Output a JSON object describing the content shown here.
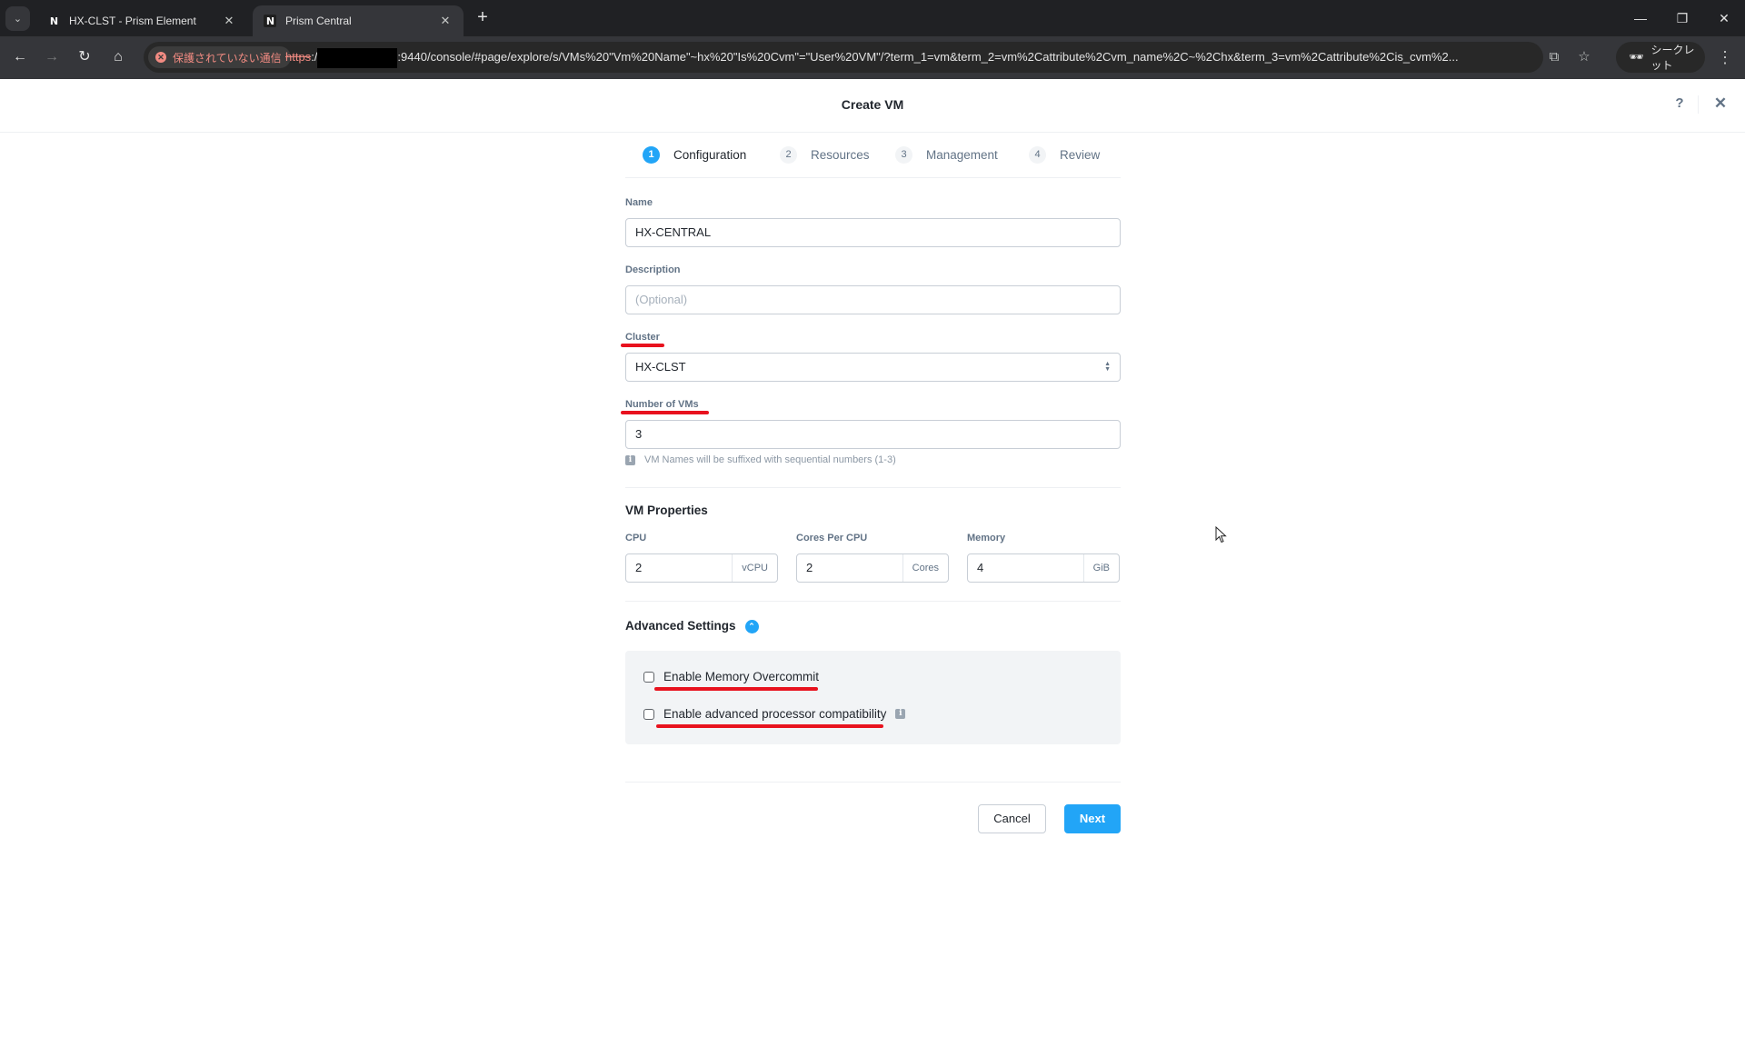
{
  "browser": {
    "tabs": [
      {
        "title": "HX-CLST - Prism Element",
        "favicon": "N",
        "active": false
      },
      {
        "title": "Prism Central",
        "favicon": "N",
        "active": true
      }
    ],
    "security_label": "保護されていない通信",
    "url_scheme": "https",
    "url_sep": ":/",
    "url_rest": ":9440/console/#page/explore/s/VMs%20\"Vm%20Name\"~hx%20\"Is%20Cvm\"=\"User%20VM\"/?term_1=vm&term_2=vm%2Cattribute%2Cvm_name%2C~%2Chx&term_3=vm%2Cattribute%2Cis_cvm%2...",
    "incognito_label": "シークレット"
  },
  "modal": {
    "title": "Create VM",
    "help_label": "?",
    "close_label": "✕"
  },
  "stepper": [
    {
      "num": "1",
      "label": "Configuration",
      "active": true
    },
    {
      "num": "2",
      "label": "Resources",
      "active": false
    },
    {
      "num": "3",
      "label": "Management",
      "active": false
    },
    {
      "num": "4",
      "label": "Review",
      "active": false
    }
  ],
  "form": {
    "name": {
      "label": "Name",
      "value": "HX-CENTRAL"
    },
    "description": {
      "label": "Description",
      "placeholder": "(Optional)"
    },
    "cluster": {
      "label": "Cluster",
      "value": "HX-CLST"
    },
    "num_vms": {
      "label": "Number of VMs",
      "value": "3",
      "hint": "VM Names will be suffixed with sequential numbers (1-3)"
    },
    "vm_properties": {
      "title": "VM Properties",
      "cpu": {
        "label": "CPU",
        "value": "2",
        "unit": "vCPU"
      },
      "cores": {
        "label": "Cores Per CPU",
        "value": "2",
        "unit": "Cores"
      },
      "memory": {
        "label": "Memory",
        "value": "4",
        "unit": "GiB"
      }
    },
    "advanced": {
      "title": "Advanced Settings",
      "expanded": true,
      "options": [
        {
          "label": "Enable Memory Overcommit",
          "checked": false
        },
        {
          "label": "Enable advanced processor compatibility",
          "checked": false
        }
      ]
    }
  },
  "footer": {
    "cancel_label": "Cancel",
    "next_label": "Next"
  },
  "colors": {
    "accent": "#22a5f7",
    "annotation_red": "#e8121e"
  }
}
